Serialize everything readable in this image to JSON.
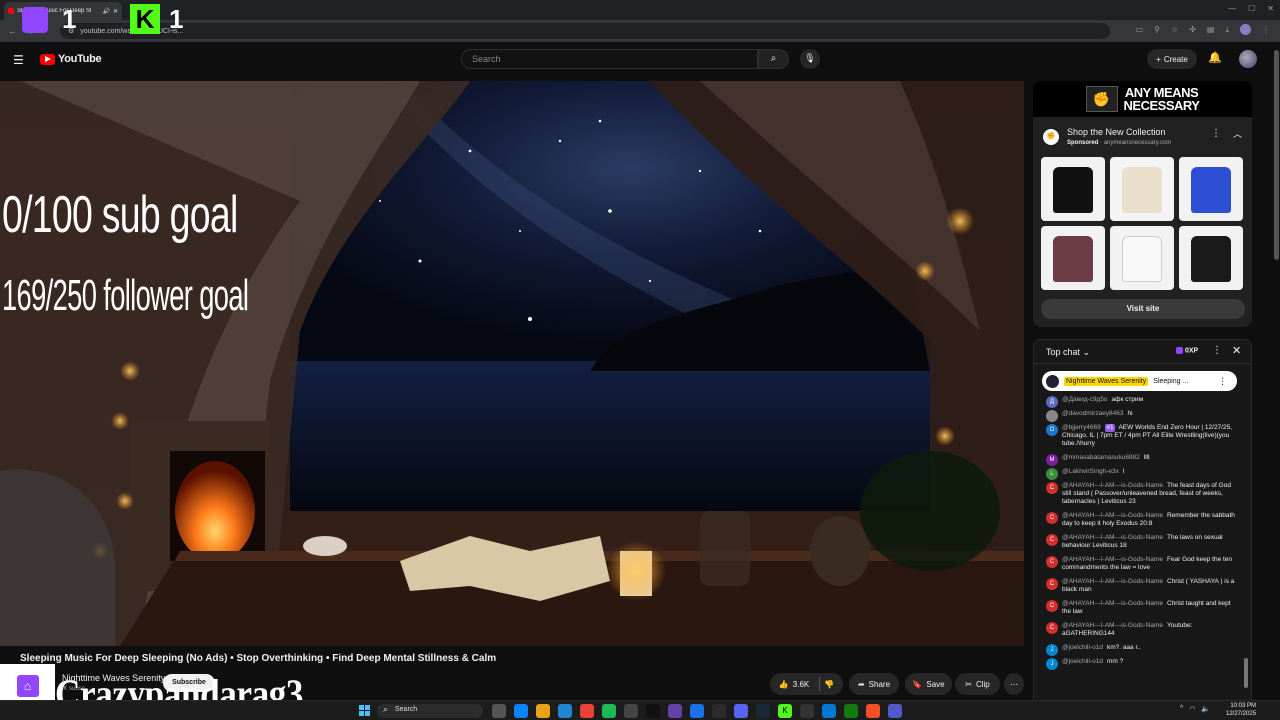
{
  "browser": {
    "tab_title": "Sleeping Music For Deep Sl",
    "url": "youtube.com/watch?v=...UCI-is..."
  },
  "header": {
    "logo_text": "YouTube",
    "search_placeholder": "Search",
    "create_label": "Create"
  },
  "stream_overlay": {
    "sub_goal": "0/100 sub goal",
    "follower_goal": "169/250 follower goal",
    "twitch_count": "1",
    "kick_logo": "K",
    "kick_count": "1",
    "streamer_name": "Crazypandarag3"
  },
  "video": {
    "title": "Sleeping Music For Deep Sleeping (No Ads) • Stop Overthinking • Find Deep Mental Stillness & Calm",
    "channel": "Nighttime Waves Serenity",
    "subscribers": "1K subsc...",
    "subscribe_label": "Subscribe",
    "likes": "3.6K",
    "share_label": "Share",
    "save_label": "Save",
    "clip_label": "Clip"
  },
  "ad": {
    "brand_line1": "ANY MEANS",
    "brand_line2": "NECESSARY",
    "title": "Shop the New Collection",
    "sponsored": "Sponsored",
    "domain": "anymeansnecessary.com",
    "visit_label": "Visit site",
    "products": [
      {
        "name": "black hoodie",
        "bg": "#f2f2f2",
        "fg": "#111"
      },
      {
        "name": "cream socks",
        "bg": "#f4f4f4",
        "fg": "#e9dfcb"
      },
      {
        "name": "blue tee",
        "bg": "#f2f2f2",
        "fg": "#2c4fd6"
      },
      {
        "name": "puffer jacket",
        "bg": "#f2f2f2",
        "fg": "#6b3b46"
      },
      {
        "name": "white tee",
        "bg": "#f2f2f2",
        "fg": "#f8f8f8"
      },
      {
        "name": "black tee",
        "bg": "#f2f2f2",
        "fg": "#1a1a1a"
      }
    ]
  },
  "chat": {
    "mode": "Top chat",
    "xp": "0XP",
    "pinned_name": "Nighttime Waves Serenity",
    "pinned_text": "Sleeping ...",
    "messages": [
      {
        "initial": "Д",
        "color": "#5c6bc0",
        "user": "@Давид-с9д5о",
        "text": "афк стрим",
        "badge": ""
      },
      {
        "initial": "",
        "color": "#888888",
        "user": "@davodmirzaey8463",
        "text": "hi",
        "badge": ""
      },
      {
        "initial": "O",
        "color": "#1976d2",
        "user": "@bjjerry4669",
        "text": "AEW Worlds End Zero Hour | 12/27/25, Chicago, IL | 7pm ET / 4pm PT All Elite Wrestling(live)(you tube./\\hurry",
        "badge": "#1"
      },
      {
        "initial": "M",
        "color": "#7b1fa2",
        "user": "@mmasabatamasuku6982",
        "text": "llll",
        "badge": ""
      },
      {
        "initial": "L",
        "color": "#388e3c",
        "user": "@LakhvirSingh-e3x",
        "text": "l",
        "badge": ""
      },
      {
        "initial": "C",
        "color": "#d32f2f",
        "user": "@AHAYAH---I-AM---is-Gods-Name",
        "text": "The feast days of God still stand ( Passover/unleavened bread, feast of weeks, tabernacles ) Leviticus 23",
        "badge": ""
      },
      {
        "initial": "C",
        "color": "#d32f2f",
        "user": "@AHAYAH---I-AM---is-Gods-Name",
        "text": "Remember the sabbath day to keep it holy Exodus 20:8",
        "badge": ""
      },
      {
        "initial": "C",
        "color": "#d32f2f",
        "user": "@AHAYAH---I-AM---is-Gods-Name",
        "text": "The laws on sexual behaviour Leviticus 18",
        "badge": ""
      },
      {
        "initial": "C",
        "color": "#d32f2f",
        "user": "@AHAYAH---I-AM---is-Gods-Name",
        "text": "Fear God keep the ten commandments the law = love",
        "badge": ""
      },
      {
        "initial": "C",
        "color": "#d32f2f",
        "user": "@AHAYAH---I-AM---is-Gods-Name",
        "text": "Christ ( YASHAYA ) is a black man",
        "badge": ""
      },
      {
        "initial": "C",
        "color": "#d32f2f",
        "user": "@AHAYAH---I-AM---is-Gods-Name",
        "text": "Christ taught and kept the law",
        "badge": ""
      },
      {
        "initial": "C",
        "color": "#d32f2f",
        "user": "@AHAYAH---I-AM---is-Gods-Name",
        "text": "Youtube: aGATHERING144",
        "badge": ""
      },
      {
        "initial": "J",
        "color": "#0288d1",
        "user": "@joelchill-o1d",
        "text": "km?. aaa r..",
        "badge": ""
      },
      {
        "initial": "J",
        "color": "#0288d1",
        "user": "@joelchill-o1d",
        "text": "mm ?",
        "badge": ""
      }
    ]
  },
  "taskbar": {
    "search": "Search",
    "time": "10:03 PM",
    "date": "12/27/2025"
  }
}
